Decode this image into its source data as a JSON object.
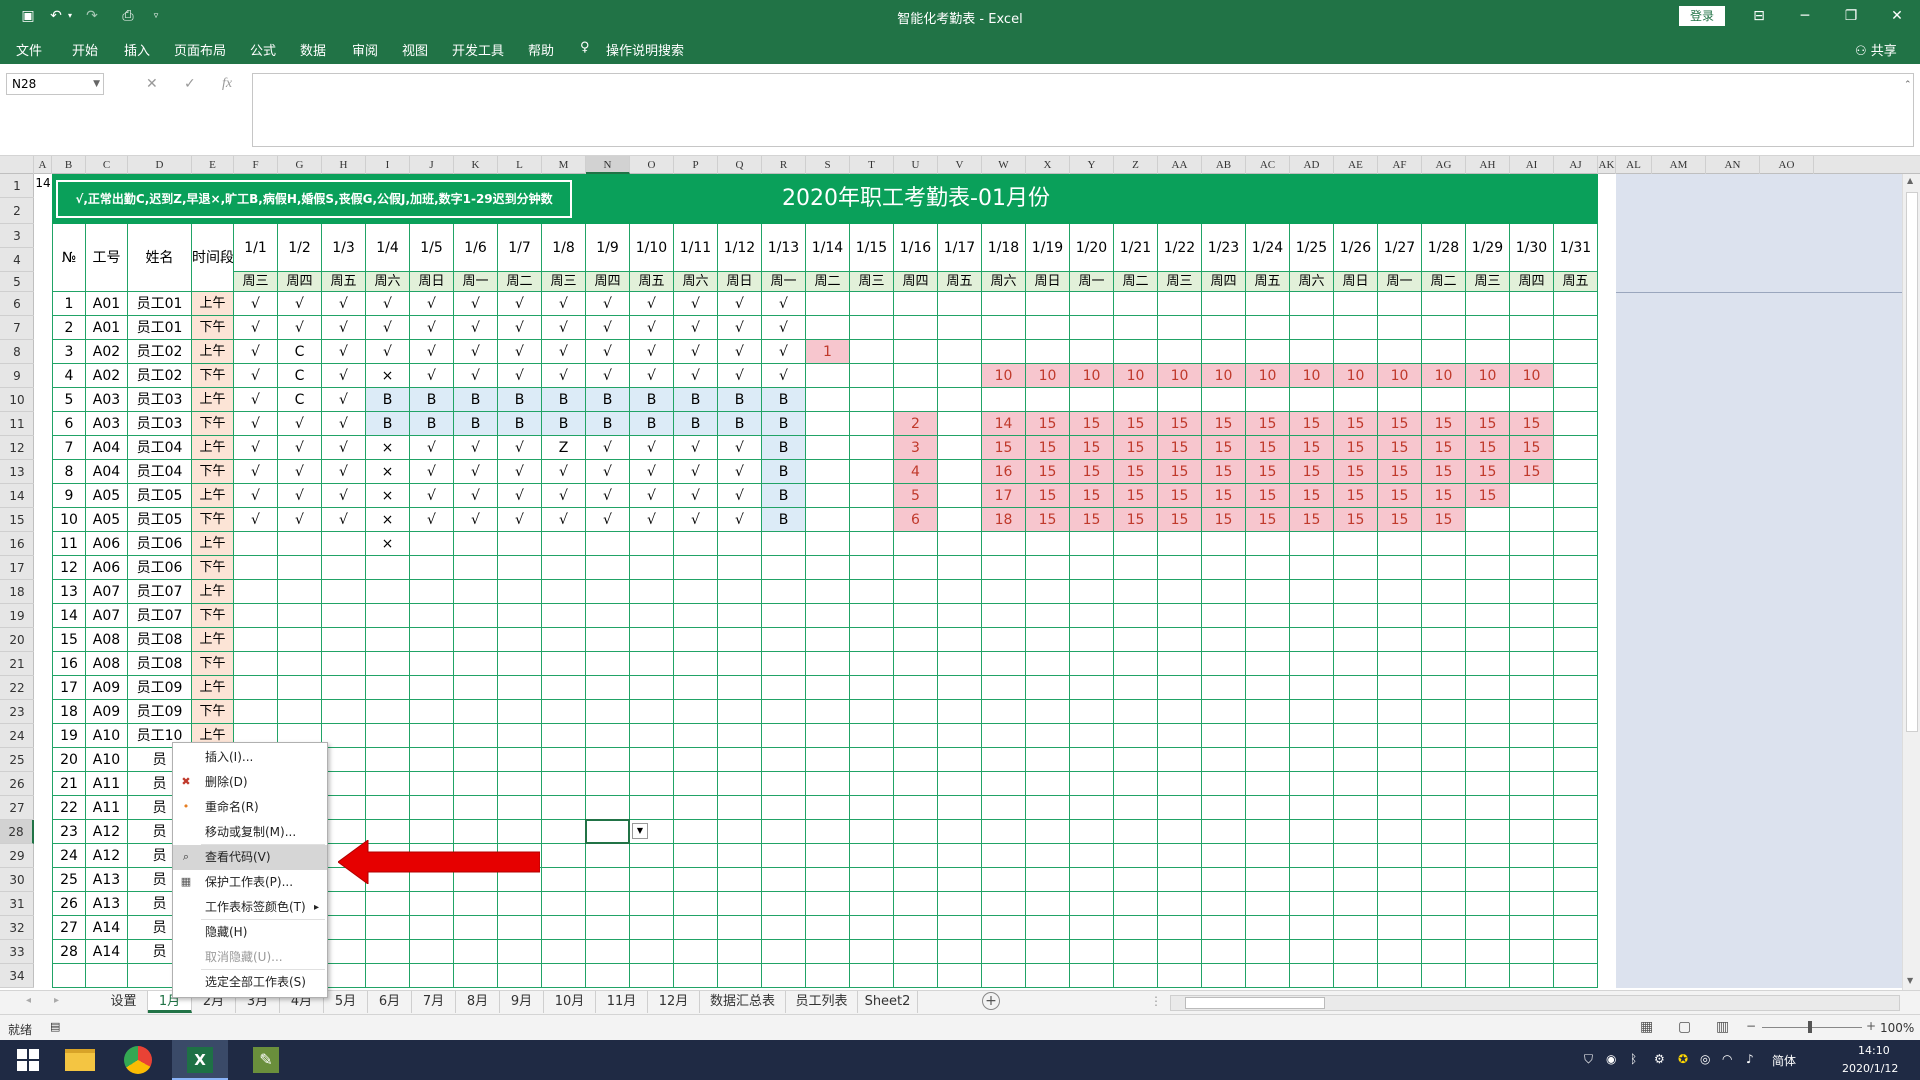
{
  "window": {
    "title": "智能化考勤表  -  Excel",
    "login": "登录"
  },
  "menu": [
    "文件",
    "开始",
    "插入",
    "页面布局",
    "公式",
    "数据",
    "审阅",
    "视图",
    "开发工具",
    "帮助",
    "操作说明搜索"
  ],
  "share": "共享",
  "namebox": "N28",
  "fx": "fx",
  "columns": [
    "A",
    "B",
    "C",
    "D",
    "E",
    "F",
    "G",
    "H",
    "I",
    "J",
    "K",
    "L",
    "M",
    "N",
    "O",
    "P",
    "Q",
    "R",
    "S",
    "T",
    "U",
    "V",
    "W",
    "X",
    "Y",
    "Z",
    "AA",
    "AB",
    "AC",
    "AD",
    "AE",
    "AF",
    "AG",
    "AH",
    "AI",
    "AJ",
    "AK",
    "AL",
    "AM",
    "AN",
    "AO",
    "A"
  ],
  "rows": [
    "1",
    "2",
    "3",
    "4",
    "5",
    "6",
    "7",
    "8",
    "9",
    "10",
    "11",
    "12",
    "13",
    "14",
    "15",
    "16",
    "17",
    "18",
    "19",
    "20",
    "21",
    "22",
    "23",
    "24",
    "25",
    "26",
    "27",
    "28",
    "29",
    "30",
    "31",
    "32",
    "33",
    "34"
  ],
  "a1": "14",
  "sheet": {
    "legend": "√,正常出勤C,迟到Z,早退×,旷工B,病假H,婚假S,丧假G,公假J,加班,数字1-29迟到分钟数",
    "title": "2020年职工考勤表-01月份",
    "headers": {
      "no": "№",
      "id": "工号",
      "name": "姓名",
      "period": "时间段"
    },
    "dates": [
      "1/1",
      "1/2",
      "1/3",
      "1/4",
      "1/5",
      "1/6",
      "1/7",
      "1/8",
      "1/9",
      "1/10",
      "1/11",
      "1/12",
      "1/13",
      "1/14",
      "1/15",
      "1/16",
      "1/17",
      "1/18",
      "1/19",
      "1/20",
      "1/21",
      "1/22",
      "1/23",
      "1/24",
      "1/25",
      "1/26",
      "1/27",
      "1/28",
      "1/29",
      "1/30",
      "1/31"
    ],
    "weekdays": [
      "周三",
      "周四",
      "周五",
      "周六",
      "周日",
      "周一",
      "周二",
      "周三",
      "周四",
      "周五",
      "周六",
      "周日",
      "周一",
      "周二",
      "周三",
      "周四",
      "周五",
      "周六",
      "周日",
      "周一",
      "周二",
      "周三",
      "周四",
      "周五",
      "周六",
      "周日",
      "周一",
      "周二",
      "周三",
      "周四",
      "周五"
    ],
    "records": [
      {
        "no": "1",
        "id": "A01",
        "name": "员工01",
        "period": "上午",
        "marks": [
          "√",
          "√",
          "√",
          "√",
          "√",
          "√",
          "√",
          "√",
          "√",
          "√",
          "√",
          "√",
          "√",
          "",
          "",
          "",
          "",
          "",
          "",
          "",
          "",
          "",
          "",
          "",
          "",
          "",
          "",
          "",
          "",
          "",
          ""
        ]
      },
      {
        "no": "2",
        "id": "A01",
        "name": "员工01",
        "period": "下午",
        "marks": [
          "√",
          "√",
          "√",
          "√",
          "√",
          "√",
          "√",
          "√",
          "√",
          "√",
          "√",
          "√",
          "√",
          "",
          "",
          "",
          "",
          "",
          "",
          "",
          "",
          "",
          "",
          "",
          "",
          "",
          "",
          "",
          "",
          "",
          ""
        ]
      },
      {
        "no": "3",
        "id": "A02",
        "name": "员工02",
        "period": "上午",
        "marks": [
          "√",
          "C",
          "√",
          "√",
          "√",
          "√",
          "√",
          "√",
          "√",
          "√",
          "√",
          "√",
          "√",
          "1",
          "",
          "",
          "",
          "",
          "",
          "",
          "",
          "",
          "",
          "",
          "",
          "",
          "",
          "",
          "",
          "",
          ""
        ]
      },
      {
        "no": "4",
        "id": "A02",
        "name": "员工02",
        "period": "下午",
        "marks": [
          "√",
          "C",
          "√",
          "×",
          "√",
          "√",
          "√",
          "√",
          "√",
          "√",
          "√",
          "√",
          "√",
          "",
          "",
          "",
          "",
          "10",
          "10",
          "10",
          "10",
          "10",
          "10",
          "10",
          "10",
          "10",
          "10",
          "10",
          "10",
          "10",
          ""
        ]
      },
      {
        "no": "5",
        "id": "A03",
        "name": "员工03",
        "period": "上午",
        "marks": [
          "√",
          "C",
          "√",
          "B",
          "B",
          "B",
          "B",
          "B",
          "B",
          "B",
          "B",
          "B",
          "B",
          "",
          "",
          "",
          "",
          "",
          "",
          "",
          "",
          "",
          "",
          "",
          "",
          "",
          "",
          "",
          "",
          "",
          ""
        ]
      },
      {
        "no": "6",
        "id": "A03",
        "name": "员工03",
        "period": "下午",
        "marks": [
          "√",
          "√",
          "√",
          "B",
          "B",
          "B",
          "B",
          "B",
          "B",
          "B",
          "B",
          "B",
          "B",
          "",
          "",
          "2",
          "",
          "14",
          "15",
          "15",
          "15",
          "15",
          "15",
          "15",
          "15",
          "15",
          "15",
          "15",
          "15",
          "15",
          ""
        ]
      },
      {
        "no": "7",
        "id": "A04",
        "name": "员工04",
        "period": "上午",
        "marks": [
          "√",
          "√",
          "√",
          "×",
          "√",
          "√",
          "√",
          "Z",
          "√",
          "√",
          "√",
          "√",
          "B",
          "",
          "",
          "3",
          "",
          "15",
          "15",
          "15",
          "15",
          "15",
          "15",
          "15",
          "15",
          "15",
          "15",
          "15",
          "15",
          "15",
          ""
        ]
      },
      {
        "no": "8",
        "id": "A04",
        "name": "员工04",
        "period": "下午",
        "marks": [
          "√",
          "√",
          "√",
          "×",
          "√",
          "√",
          "√",
          "√",
          "√",
          "√",
          "√",
          "√",
          "B",
          "",
          "",
          "4",
          "",
          "16",
          "15",
          "15",
          "15",
          "15",
          "15",
          "15",
          "15",
          "15",
          "15",
          "15",
          "15",
          "15",
          ""
        ]
      },
      {
        "no": "9",
        "id": "A05",
        "name": "员工05",
        "period": "上午",
        "marks": [
          "√",
          "√",
          "√",
          "×",
          "√",
          "√",
          "√",
          "√",
          "√",
          "√",
          "√",
          "√",
          "B",
          "",
          "",
          "5",
          "",
          "17",
          "15",
          "15",
          "15",
          "15",
          "15",
          "15",
          "15",
          "15",
          "15",
          "15",
          "15",
          "",
          ""
        ]
      },
      {
        "no": "10",
        "id": "A05",
        "name": "员工05",
        "period": "下午",
        "marks": [
          "√",
          "√",
          "√",
          "×",
          "√",
          "√",
          "√",
          "√",
          "√",
          "√",
          "√",
          "√",
          "B",
          "",
          "",
          "6",
          "",
          "18",
          "15",
          "15",
          "15",
          "15",
          "15",
          "15",
          "15",
          "15",
          "15",
          "15",
          "",
          "",
          ""
        ]
      },
      {
        "no": "11",
        "id": "A06",
        "name": "员工06",
        "period": "上午",
        "marks": [
          "",
          "",
          "",
          "×",
          "",
          "",
          "",
          "",
          "",
          "",
          "",
          "",
          "",
          "",
          "",
          "",
          "",
          "",
          "",
          "",
          "",
          "",
          "",
          "",
          "",
          "",
          "",
          "",
          "",
          "",
          ""
        ]
      },
      {
        "no": "12",
        "id": "A06",
        "name": "员工06",
        "period": "下午",
        "marks": []
      },
      {
        "no": "13",
        "id": "A07",
        "name": "员工07",
        "period": "上午",
        "marks": []
      },
      {
        "no": "14",
        "id": "A07",
        "name": "员工07",
        "period": "下午",
        "marks": []
      },
      {
        "no": "15",
        "id": "A08",
        "name": "员工08",
        "period": "上午",
        "marks": []
      },
      {
        "no": "16",
        "id": "A08",
        "name": "员工08",
        "period": "下午",
        "marks": []
      },
      {
        "no": "17",
        "id": "A09",
        "name": "员工09",
        "period": "上午",
        "marks": []
      },
      {
        "no": "18",
        "id": "A09",
        "name": "员工09",
        "period": "下午",
        "marks": []
      },
      {
        "no": "19",
        "id": "A10",
        "name": "员工10",
        "period": "上午",
        "marks": []
      },
      {
        "no": "20",
        "id": "A10",
        "name": "员",
        "period": "",
        "marks": []
      },
      {
        "no": "21",
        "id": "A11",
        "name": "员",
        "period": "",
        "marks": []
      },
      {
        "no": "22",
        "id": "A11",
        "name": "员",
        "period": "",
        "marks": []
      },
      {
        "no": "23",
        "id": "A12",
        "name": "员",
        "period": "",
        "marks": []
      },
      {
        "no": "24",
        "id": "A12",
        "name": "员",
        "period": "",
        "marks": []
      },
      {
        "no": "25",
        "id": "A13",
        "name": "员",
        "period": "",
        "marks": []
      },
      {
        "no": "26",
        "id": "A13",
        "name": "员",
        "period": "",
        "marks": []
      },
      {
        "no": "27",
        "id": "A14",
        "name": "员",
        "period": "",
        "marks": []
      },
      {
        "no": "28",
        "id": "A14",
        "name": "员",
        "period": "",
        "marks": []
      }
    ]
  },
  "context_menu": [
    {
      "label": "插入(I)...",
      "icon": "",
      "disabled": false
    },
    {
      "label": "删除(D)",
      "icon": "delete-icon",
      "disabled": false
    },
    {
      "label": "重命名(R)",
      "icon": "rename-icon",
      "disabled": false
    },
    {
      "label": "移动或复制(M)...",
      "icon": "",
      "disabled": false
    },
    {
      "label": "查看代码(V)",
      "icon": "view-code-icon",
      "disabled": false,
      "highlight": true
    },
    {
      "label": "保护工作表(P)...",
      "icon": "protect-sheet-icon",
      "disabled": false
    },
    {
      "label": "工作表标签颜色(T)",
      "icon": "",
      "disabled": false,
      "submenu": true
    },
    {
      "label": "隐藏(H)",
      "icon": "",
      "disabled": false
    },
    {
      "label": "取消隐藏(U)...",
      "icon": "",
      "disabled": true
    },
    {
      "label": "选定全部工作表(S)",
      "icon": "",
      "disabled": false
    }
  ],
  "sheet_tabs": [
    "设置",
    "1月",
    "2月",
    "3月",
    "4月",
    "5月",
    "6月",
    "7月",
    "8月",
    "9月",
    "10月",
    "11月",
    "12月",
    "数据汇总表",
    "员工列表",
    "Sheet2"
  ],
  "active_tab": "1月",
  "status": {
    "ready": "就绪",
    "zoom": "100%"
  },
  "taskbar": {
    "ime": "简体",
    "time": "14:10",
    "date": "2020/1/12"
  },
  "colors": {
    "excel_green": "#217346",
    "banner_green": "#0aa05a",
    "grid_green": "#21a366",
    "pink": "#f7c6ce",
    "blue": "#dcebf7",
    "peach": "#fce4d6",
    "weekday_green": "#e2f0d9",
    "panel": "#dce2ee",
    "arrow_red": "#e60000"
  }
}
